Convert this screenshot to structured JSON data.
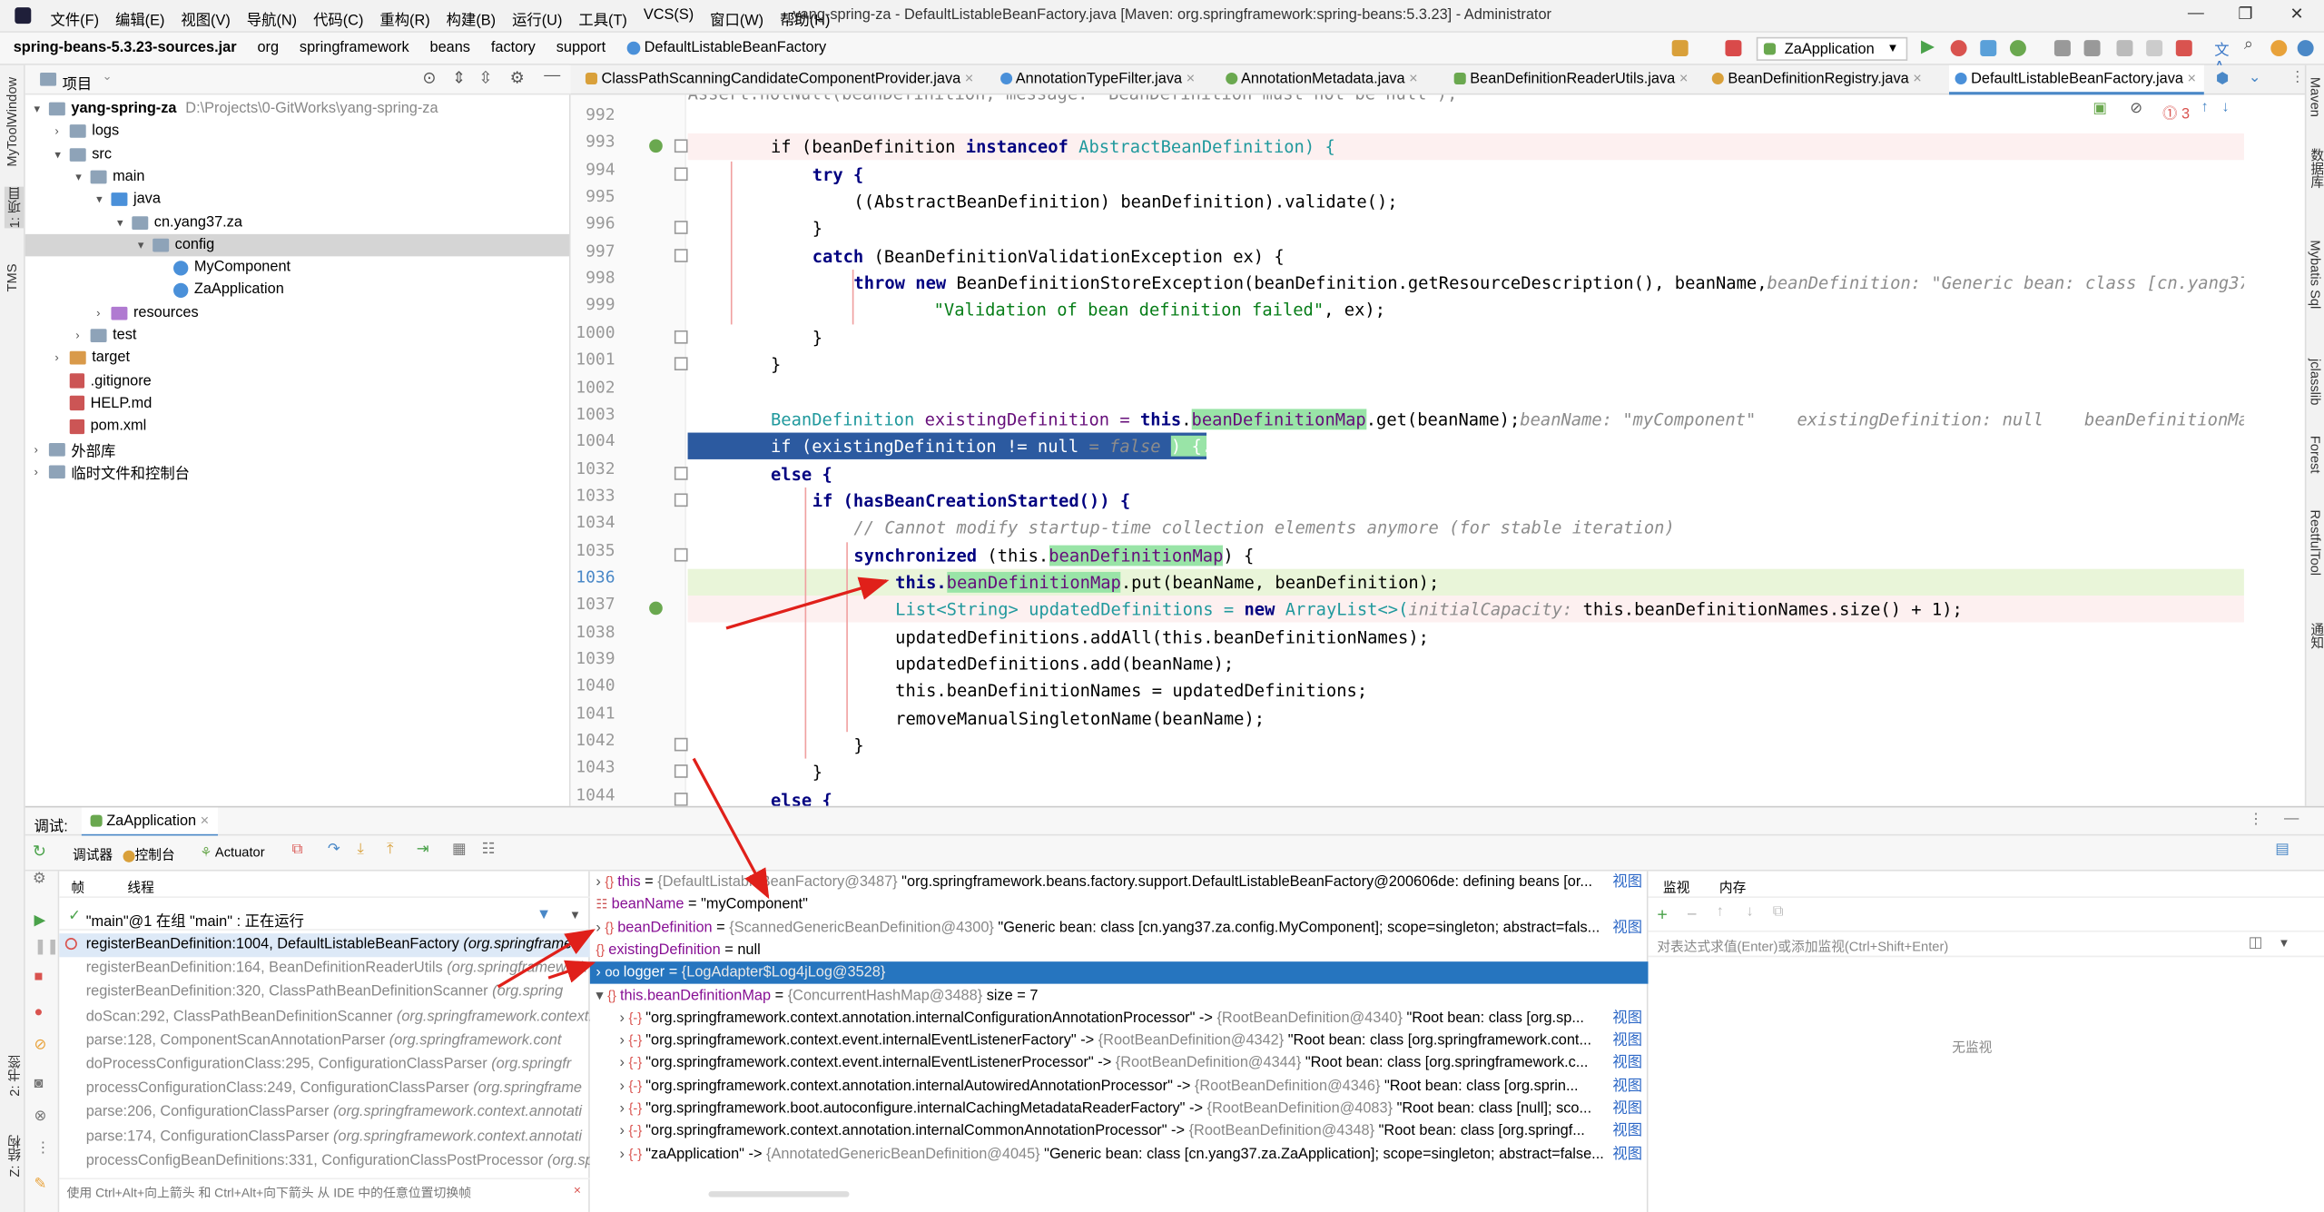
{
  "menubar": {
    "items": [
      "文件(F)",
      "编辑(E)",
      "视图(V)",
      "导航(N)",
      "代码(C)",
      "重构(R)",
      "构建(B)",
      "运行(U)",
      "工具(T)",
      "VCS(S)",
      "窗口(W)",
      "帮助(H)"
    ],
    "window_title": "yang-spring-za - DefaultListableBeanFactory.java [Maven: org.springframework:spring-beans:5.3.23] - Administrator"
  },
  "navbar": {
    "crumbs": [
      "spring-beans-5.3.23-sources.jar",
      "org",
      "springframework",
      "beans",
      "factory",
      "support",
      "DefaultListableBeanFactory"
    ],
    "run_config": "ZaApplication"
  },
  "left_strip": {
    "labels": [
      "MyToolWindow",
      "1: 项目",
      "TMS",
      "2: 书签",
      "Z: 结构"
    ]
  },
  "project": {
    "header": "项目",
    "tree": [
      {
        "label": "yang-spring-za",
        "hint": "D:\\Projects\\0-GitWorks\\yang-spring-za",
        "arrow": "▾",
        "kind": "folder"
      },
      {
        "label": "logs",
        "arrow": "›",
        "kind": "folder"
      },
      {
        "label": "src",
        "arrow": "▾",
        "kind": "folder"
      },
      {
        "label": "main",
        "arrow": "▾",
        "kind": "folder"
      },
      {
        "label": "java",
        "arrow": "▾",
        "kind": "blue"
      },
      {
        "label": "cn.yang37.za",
        "arrow": "▾",
        "kind": "folder"
      },
      {
        "label": "config",
        "arrow": "▾",
        "kind": "folder"
      },
      {
        "label": "MyComponent",
        "arrow": "",
        "kind": "class"
      },
      {
        "label": "ZaApplication",
        "arrow": "",
        "kind": "class"
      },
      {
        "label": "resources",
        "arrow": "›",
        "kind": "purple"
      },
      {
        "label": "test",
        "arrow": "›",
        "kind": "folder"
      },
      {
        "label": "target",
        "arrow": "›",
        "kind": "orange"
      },
      {
        "label": ".gitignore",
        "arrow": "",
        "kind": "file"
      },
      {
        "label": "HELP.md",
        "arrow": "",
        "kind": "file"
      },
      {
        "label": "pom.xml",
        "arrow": "",
        "kind": "file"
      },
      {
        "label": "外部库",
        "arrow": "›",
        "kind": "folder"
      },
      {
        "label": "临时文件和控制台",
        "arrow": "›",
        "kind": "folder"
      }
    ]
  },
  "tabs": [
    "ClassPathScanningCandidateComponentProvider.java",
    "AnnotationTypeFilter.java",
    "AnnotationMetadata.java",
    "BeanDefinitionReaderUtils.java",
    "BeanDefinitionRegistry.java",
    "DefaultListableBeanFactory.java"
  ],
  "editor": {
    "top_partial": "Assert.notNull(beanDefinition, message: \"BeanDefinition must not be null\");",
    "lines": [
      "992",
      "993",
      "994",
      "995",
      "996",
      "997",
      "998",
      "999",
      "1000",
      "1001",
      "1002",
      "1003",
      "1004",
      "1032",
      "1033",
      "1034",
      "1035",
      "1036",
      "1037",
      "1038",
      "1039",
      "1040",
      "1041",
      "1042",
      "1043",
      "1044"
    ],
    "code": {
      "l993a": "if (beanDefinition ",
      "l993b": "instanceof ",
      "l993c": "AbstractBeanDefinition) {",
      "l994": "try {",
      "l995": "((AbstractBeanDefinition) beanDefinition).validate();",
      "l996": "}",
      "l997a": "catch ",
      "l997b": "(BeanDefinitionValidationException ex) {",
      "l998a": "throw new ",
      "l998b": "BeanDefinitionStoreException(beanDefinition.getResourceDescription(), beanName,",
      "l998hint": "beanDefinition: \"Generic bean: class [cn.yang37.",
      "l999a": "\"Validation of bean definition failed\"",
      "l999b": ", ex);",
      "l1000": "}",
      "l1001": "}",
      "l1003a": "BeanDefinition ",
      "l1003b": "existingDefinition = ",
      "l1003c": "this",
      "l1003d": ".",
      "l1003e": "beanDefinitionMap",
      "l1003f": ".get(beanName);",
      "l1003hint": "beanName: \"myComponent\"    existingDefinition: null    beanDefinitionMap",
      "l1004a": "if (existingDefinition != null",
      "l1004b": " = false ",
      "l1004c": ") {...}",
      "l1032": "else {",
      "l1033": "if (hasBeanCreationStarted()) {",
      "l1034": "// Cannot modify startup-time collection elements anymore (for stable iteration)",
      "l1035a": "synchronized ",
      "l1035b": "(this.",
      "l1035c": "beanDefinitionMap",
      "l1035d": ") {",
      "l1036a": "this.",
      "l1036b": "beanDefinitionMap",
      "l1036c": ".put(beanName, beanDefinition);",
      "l1037a": "List<String> updatedDefinitions = ",
      "l1037b": "new ",
      "l1037c": "ArrayList<>(",
      "l1037hint": "initialCapacity: ",
      "l1037d": "this.beanDefinitionNames.size() + 1);",
      "l1038": "updatedDefinitions.addAll(this.beanDefinitionNames);",
      "l1039": "updatedDefinitions.add(beanName);",
      "l1040": "this.beanDefinitionNames = updatedDefinitions;",
      "l1041": "removeManualSingletonName(beanName);",
      "l1042": "}",
      "l1043": "}",
      "l1044": "else {"
    },
    "warnings_count": "3"
  },
  "right_strip": {
    "labels": [
      "Maven",
      "数据库",
      "Mybatis Sql",
      "jclasslib",
      "Forest",
      "RestfulTool",
      "通知"
    ]
  },
  "debug": {
    "label": "调试:",
    "session": "ZaApplication",
    "toolbar": [
      "调试器",
      "控制台",
      "Actuator"
    ],
    "sub_tabs": [
      "帧",
      "线程"
    ],
    "thread": "\"main\"@1 在组 \"main\" : 正在运行",
    "frames": [
      {
        "method": "registerBeanDefinition:1004, DefaultListableBeanFactory",
        "cls": "(org.springframew"
      },
      {
        "method": "registerBeanDefinition:164, BeanDefinitionReaderUtils",
        "cls": "(org.springframework"
      },
      {
        "method": "registerBeanDefinition:320, ClassPathBeanDefinitionScanner",
        "cls": "(org.spring"
      },
      {
        "method": "doScan:292, ClassPathBeanDefinitionScanner",
        "cls": "(org.springframework.context."
      },
      {
        "method": "parse:128, ComponentScanAnnotationParser",
        "cls": "(org.springframework.cont"
      },
      {
        "method": "doProcessConfigurationClass:295, ConfigurationClassParser",
        "cls": "(org.springfr"
      },
      {
        "method": "processConfigurationClass:249, ConfigurationClassParser",
        "cls": "(org.springframe"
      },
      {
        "method": "parse:206, ConfigurationClassParser",
        "cls": "(org.springframework.context.annotati"
      },
      {
        "method": "parse:174, ConfigurationClassParser",
        "cls": "(org.springframework.context.annotati"
      },
      {
        "method": "processConfigBeanDefinitions:331, ConfigurationClassPostProcessor",
        "cls": "(org.spr"
      }
    ],
    "status_hint": "使用 Ctrl+Alt+向上箭头 和 Ctrl+Alt+向下箭头 从 IDE 中的任意位置切换帧",
    "variables": [
      {
        "indent": 0,
        "name": "this",
        "eq": " = ",
        "ref": "{DefaultListableBeanFactory@3487}",
        "val": " \"org.springframework.beans.factory.support.DefaultListableBeanFactory@200606de: defining beans [or...",
        "link": "视图"
      },
      {
        "indent": 0,
        "name": "beanName",
        "eq": " = ",
        "ref": "",
        "val": "\"myComponent\"",
        "link": ""
      },
      {
        "indent": 0,
        "name": "beanDefinition",
        "eq": " = ",
        "ref": "{ScannedGenericBeanDefinition@4300}",
        "val": " \"Generic bean: class [cn.yang37.za.config.MyComponent]; scope=singleton; abstract=fals...",
        "link": "视图"
      },
      {
        "indent": 0,
        "name": "existingDefinition",
        "eq": " = ",
        "ref": "",
        "val": "null",
        "link": ""
      },
      {
        "indent": 0,
        "name": "logger",
        "eq": " = ",
        "ref": "{LogAdapter$Log4jLog@3528}",
        "val": "",
        "link": ""
      },
      {
        "indent": 0,
        "name": "this.beanDefinitionMap",
        "eq": " = ",
        "ref": "{ConcurrentHashMap@3488}",
        "val": "  size = 7",
        "link": ""
      },
      {
        "indent": 1,
        "name": "\"org.springframework.context.annotation.internalConfigurationAnnotationProcessor\"",
        "eq": " -> ",
        "ref": "{RootBeanDefinition@4340}",
        "val": " \"Root bean: class [org.sp...",
        "link": "视图"
      },
      {
        "indent": 1,
        "name": "\"org.springframework.context.event.internalEventListenerFactory\"",
        "eq": " -> ",
        "ref": "{RootBeanDefinition@4342}",
        "val": " \"Root bean: class [org.springframework.cont...",
        "link": "视图"
      },
      {
        "indent": 1,
        "name": "\"org.springframework.context.event.internalEventListenerProcessor\"",
        "eq": " -> ",
        "ref": "{RootBeanDefinition@4344}",
        "val": " \"Root bean: class [org.springframework.c...",
        "link": "视图"
      },
      {
        "indent": 1,
        "name": "\"org.springframework.context.annotation.internalAutowiredAnnotationProcessor\"",
        "eq": " -> ",
        "ref": "{RootBeanDefinition@4346}",
        "val": " \"Root bean: class [org.sprin...",
        "link": "视图"
      },
      {
        "indent": 1,
        "name": "\"org.springframework.boot.autoconfigure.internalCachingMetadataReaderFactory\"",
        "eq": " -> ",
        "ref": "{RootBeanDefinition@4083}",
        "val": " \"Root bean: class [null]; sco...",
        "link": "视图"
      },
      {
        "indent": 1,
        "name": "\"org.springframework.context.annotation.internalCommonAnnotationProcessor\"",
        "eq": " -> ",
        "ref": "{RootBeanDefinition@4348}",
        "val": " \"Root bean: class [org.springf...",
        "link": "视图"
      },
      {
        "indent": 1,
        "name": "\"zaApplication\"",
        "eq": " -> ",
        "ref": "{AnnotatedGenericBeanDefinition@4045}",
        "val": " \"Generic bean: class [cn.yang37.za.ZaApplication]; scope=singleton; abstract=false...",
        "link": "视图"
      }
    ],
    "watch_tabs": [
      "监视",
      "内存"
    ],
    "watch_placeholder": "对表达式求值(Enter)或添加监视(Ctrl+Shift+Enter)",
    "watch_empty": "无监视"
  },
  "colors": {
    "accent": "#2675bf",
    "highlight_green": "#99e4a7",
    "current_line": "#e9f5d9",
    "selection_line": "#2c5aa0",
    "arrow": "#e0201a"
  }
}
